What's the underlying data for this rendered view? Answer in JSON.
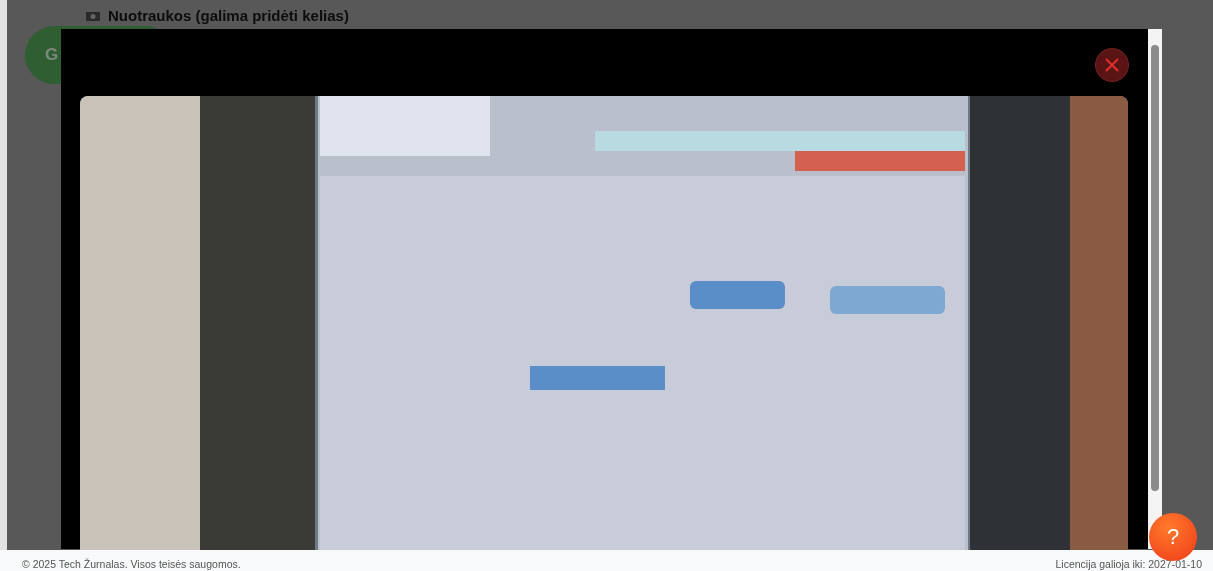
{
  "section": {
    "title": "Nuotraukos (galima pridėti kelias)"
  },
  "background_button": {
    "label": "G"
  },
  "help_button": {
    "label": "?"
  },
  "footer": {
    "copyright": "© 2025 Tech Žurnalas. Visos teisės saugomos.",
    "license": "Licencija galioja iki: 2027-01-10"
  }
}
